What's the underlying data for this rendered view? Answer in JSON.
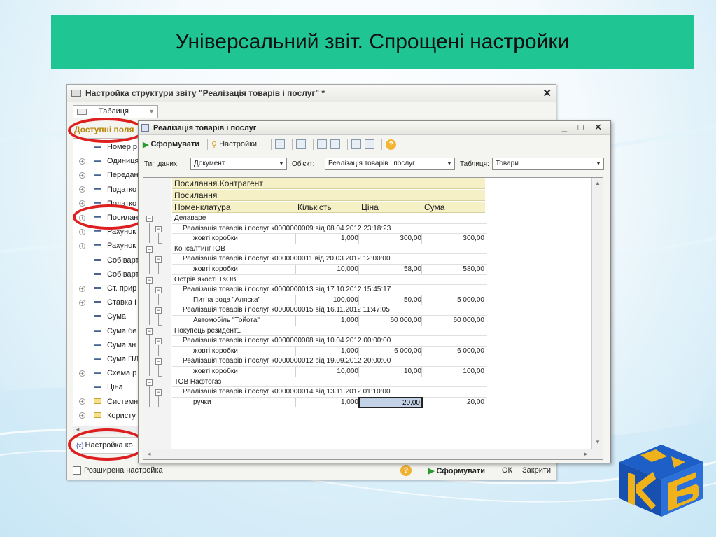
{
  "slide": {
    "title": "Універсальний звіт. Спрощені настройки"
  },
  "settings_window": {
    "title": "Настройка структури звіту \"Реалізація товарів і послуг\" *",
    "close": "✕",
    "view_combo": "Таблиця",
    "fields_label": "Доступні поля",
    "tree_items": [
      {
        "label": "Номер р",
        "kind": "field",
        "expand": false
      },
      {
        "label": "Одиниця",
        "kind": "field",
        "expand": true
      },
      {
        "label": "Передан",
        "kind": "field",
        "expand": true
      },
      {
        "label": "Податко",
        "kind": "field",
        "expand": true
      },
      {
        "label": "Податко",
        "kind": "field",
        "expand": true
      },
      {
        "label": "Посилан",
        "kind": "field",
        "expand": true
      },
      {
        "label": "Рахунок",
        "kind": "field",
        "expand": true
      },
      {
        "label": "Рахунок",
        "kind": "field",
        "expand": true
      },
      {
        "label": "Собіварт",
        "kind": "field",
        "expand": false
      },
      {
        "label": "Собіварт",
        "kind": "field",
        "expand": false
      },
      {
        "label": "Ст. прир",
        "kind": "field",
        "expand": true
      },
      {
        "label": "Ставка I",
        "kind": "field",
        "expand": true
      },
      {
        "label": "Сума",
        "kind": "field",
        "expand": false
      },
      {
        "label": "Сума бе",
        "kind": "field",
        "expand": false
      },
      {
        "label": "Сума зн",
        "kind": "field",
        "expand": false
      },
      {
        "label": "Сума ПД",
        "kind": "field",
        "expand": false
      },
      {
        "label": "Схема р",
        "kind": "field",
        "expand": true
      },
      {
        "label": "Ціна",
        "kind": "field",
        "expand": false
      },
      {
        "label": "Системн",
        "kind": "folder",
        "expand": true
      },
      {
        "label": "Користу",
        "kind": "folder",
        "expand": true
      }
    ],
    "bottom_field": "Настройка ко",
    "bottom_field_icon": "{x}",
    "extended_label": "Розширена настройка",
    "help": "?",
    "generate": "Сформувати",
    "ok": "ОК",
    "close_btn": "Закрити"
  },
  "report_window": {
    "title": "Реалізація товарів і послуг",
    "window_controls": "_ □ ✕",
    "toolbar": {
      "generate": "Сформувати",
      "settings": "Настройки...",
      "help": "?"
    },
    "params": {
      "data_type_label": "Тип даних:",
      "data_type_value": "Документ",
      "object_label": "Об'єкт:",
      "object_value": "Реалізація товарів і послуг",
      "table_label": "Таблиця:",
      "table_value": "Товари"
    },
    "grid": {
      "header_row1": "Посилання.Контрагент",
      "header_row2": "Посилання",
      "header_cols": [
        "Номенклатура",
        "Кількість",
        "Ціна",
        "Сума"
      ],
      "rows": [
        {
          "level": 0,
          "name": "Делаваре",
          "qty": "",
          "price": "",
          "sum": ""
        },
        {
          "level": 1,
          "name": "Реалізація товарів і послуг к0000000009 від 08.04.2012 23:18:23",
          "qty": "",
          "price": "",
          "sum": ""
        },
        {
          "level": 2,
          "name": "жовті коробки",
          "qty": "1,000",
          "price": "300,00",
          "sum": "300,00"
        },
        {
          "level": 0,
          "name": "КонсалтингТОВ",
          "qty": "",
          "price": "",
          "sum": ""
        },
        {
          "level": 1,
          "name": "Реалізація товарів і послуг к0000000011 від 20.03.2012 12:00:00",
          "qty": "",
          "price": "",
          "sum": ""
        },
        {
          "level": 2,
          "name": "жовті коробки",
          "qty": "10,000",
          "price": "58,00",
          "sum": "580,00"
        },
        {
          "level": 0,
          "name": "Острів якості ТзОВ",
          "qty": "",
          "price": "",
          "sum": ""
        },
        {
          "level": 1,
          "name": "Реалізація товарів і послуг к0000000013 від 17.10.2012 15:45:17",
          "qty": "",
          "price": "",
          "sum": ""
        },
        {
          "level": 2,
          "name": "Питна вода \"Аляска\"",
          "qty": "100,000",
          "price": "50,00",
          "sum": "5 000,00"
        },
        {
          "level": 1,
          "name": "Реалізація товарів і послуг к0000000015 від 16.11.2012 11:47:05",
          "qty": "",
          "price": "",
          "sum": ""
        },
        {
          "level": 2,
          "name": "Автомобіль \"Тойота\"",
          "qty": "1,000",
          "price": "60 000,00",
          "sum": "60 000,00"
        },
        {
          "level": 0,
          "name": "Покупець резидент1",
          "qty": "",
          "price": "",
          "sum": ""
        },
        {
          "level": 1,
          "name": "Реалізація товарів і послуг к0000000008 від 10.04.2012 00:00:00",
          "qty": "",
          "price": "",
          "sum": ""
        },
        {
          "level": 2,
          "name": "жовті коробки",
          "qty": "1,000",
          "price": "6 000,00",
          "sum": "6 000,00"
        },
        {
          "level": 1,
          "name": "Реалізація товарів і послуг к0000000012 від 19.09.2012 20:00:00",
          "qty": "",
          "price": "",
          "sum": ""
        },
        {
          "level": 2,
          "name": "жовті коробки",
          "qty": "10,000",
          "price": "10,00",
          "sum": "100,00"
        },
        {
          "level": 0,
          "name": "ТОВ  Нафтогаз",
          "qty": "",
          "price": "",
          "sum": ""
        },
        {
          "level": 1,
          "name": "Реалізація товарів і послуг к0000000014 від 13.11.2012 01:10:00",
          "qty": "",
          "price": "",
          "sum": ""
        },
        {
          "level": 2,
          "name": "ручки",
          "qty": "1,000",
          "price": "20,00",
          "sum": "20,00"
        }
      ]
    }
  },
  "colors": {
    "title_bar": "#1fc592",
    "highlight": "#dd1f1f",
    "header_bg": "#f5f0c6"
  }
}
